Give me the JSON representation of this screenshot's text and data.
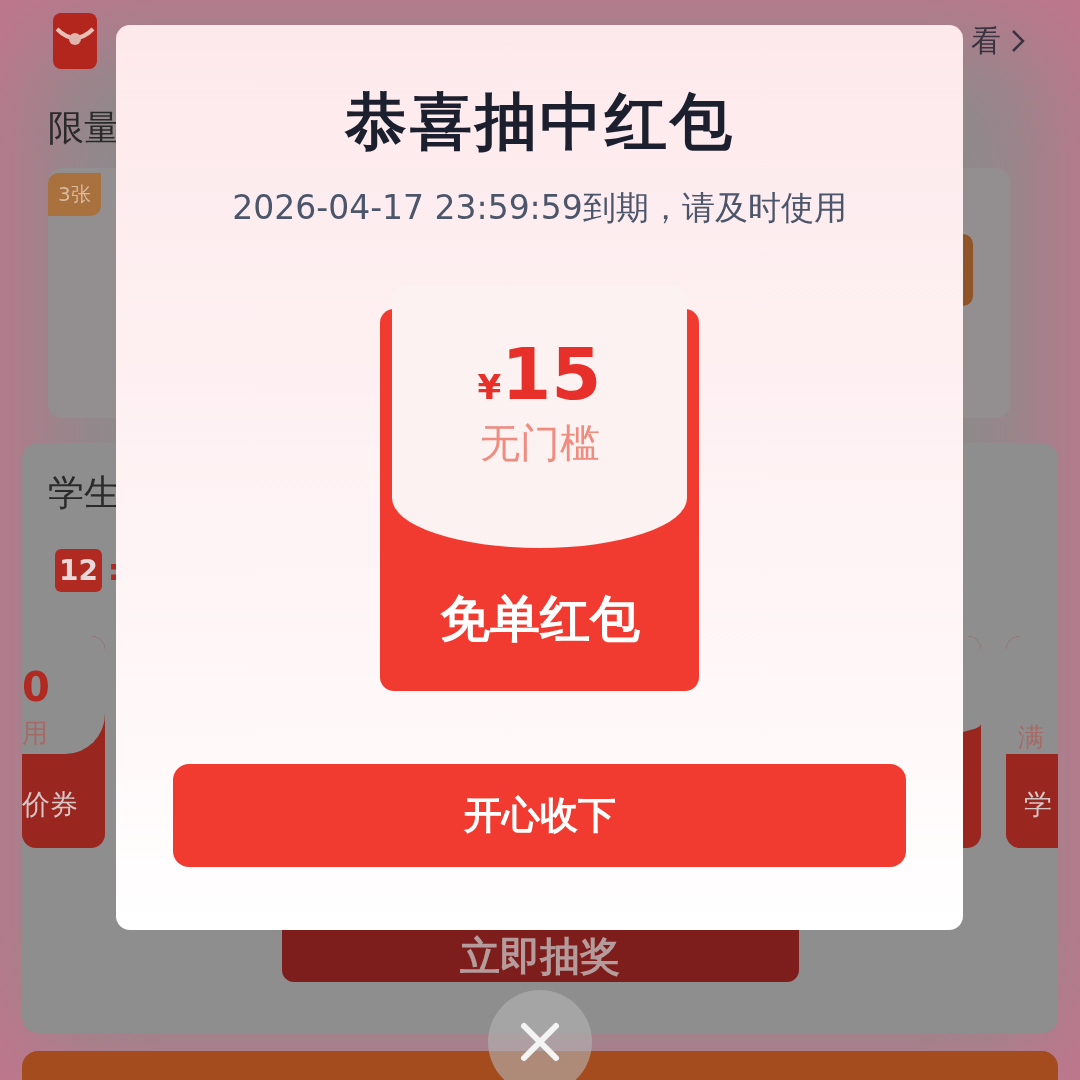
{
  "header": {
    "more_link": "看"
  },
  "limited": {
    "title": "限量",
    "badge": "3张"
  },
  "student": {
    "title": "学生",
    "timer": {
      "hours": "12",
      "separator": ":"
    },
    "coupons": [
      {
        "amount": "0",
        "condition": "用",
        "name": "价券"
      },
      {
        "kind": "hidden"
      },
      {
        "condition": "满",
        "name": "学"
      }
    ],
    "button": "立即抽奖"
  },
  "dialog": {
    "title": "恭喜抽中红包",
    "subtitle": "2026-04-17 23:59:59到期，请及时使用",
    "coupon": {
      "currency": "¥",
      "amount": "15",
      "condition": "无门槛",
      "name": "免单红包"
    },
    "button": "开心收下"
  }
}
